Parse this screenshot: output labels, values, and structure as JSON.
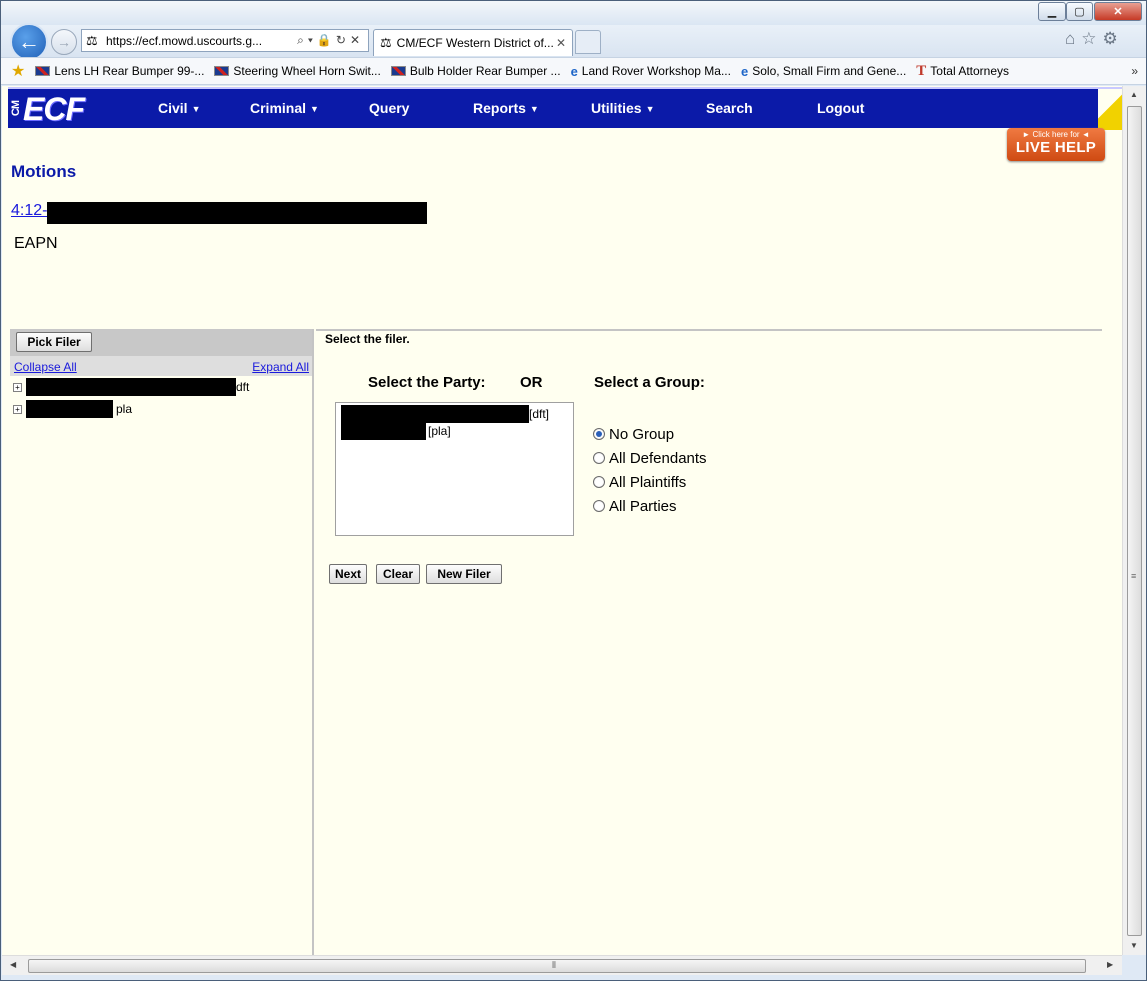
{
  "browser": {
    "address_url": "https://ecf.mowd.uscourts.g...",
    "tab_title": "CM/ECF Western District of...",
    "favorites": [
      {
        "label": "Lens LH Rear Bumper 99-...",
        "icon": "uk-flag-icon"
      },
      {
        "label": "Steering Wheel Horn Swit...",
        "icon": "uk-flag-icon"
      },
      {
        "label": "Bulb Holder Rear Bumper ...",
        "icon": "uk-flag-icon"
      },
      {
        "label": "Land Rover Workshop Ma...",
        "icon": "ie-page-icon"
      },
      {
        "label": "Solo, Small Firm and Gene...",
        "icon": "ie-page-icon"
      },
      {
        "label": "Total Attorneys",
        "icon": "total-attorneys-icon"
      }
    ]
  },
  "ecf": {
    "logo_cm": "CM",
    "logo_ecf": "ECF",
    "menu": [
      "Civil",
      "Criminal",
      "Query",
      "Reports",
      "Utilities",
      "Search",
      "Logout"
    ],
    "live_help_small": "► Click here for ◄",
    "live_help_big": "LIVE HELP"
  },
  "page": {
    "title": "Motions",
    "case_link": "4:12-",
    "case_code": "EAPN"
  },
  "left_panel": {
    "pick_filer": "Pick Filer",
    "collapse_all": "Collapse All",
    "expand_all": "Expand All",
    "tree": [
      {
        "role": "dft"
      },
      {
        "role": "pla"
      }
    ]
  },
  "right_panel": {
    "instruction": "Select the filer.",
    "party_heading": "Select the Party:",
    "or_label": "OR",
    "group_heading": "Select a Group:",
    "parties": [
      {
        "role": "[dft]"
      },
      {
        "role": "[pla]"
      }
    ],
    "groups": [
      {
        "label": "No Group",
        "checked": true
      },
      {
        "label": "All Defendants",
        "checked": false
      },
      {
        "label": "All Plaintiffs",
        "checked": false
      },
      {
        "label": "All Parties",
        "checked": false
      }
    ],
    "buttons": {
      "next": "Next",
      "clear": "Clear",
      "new_filer": "New Filer"
    }
  }
}
